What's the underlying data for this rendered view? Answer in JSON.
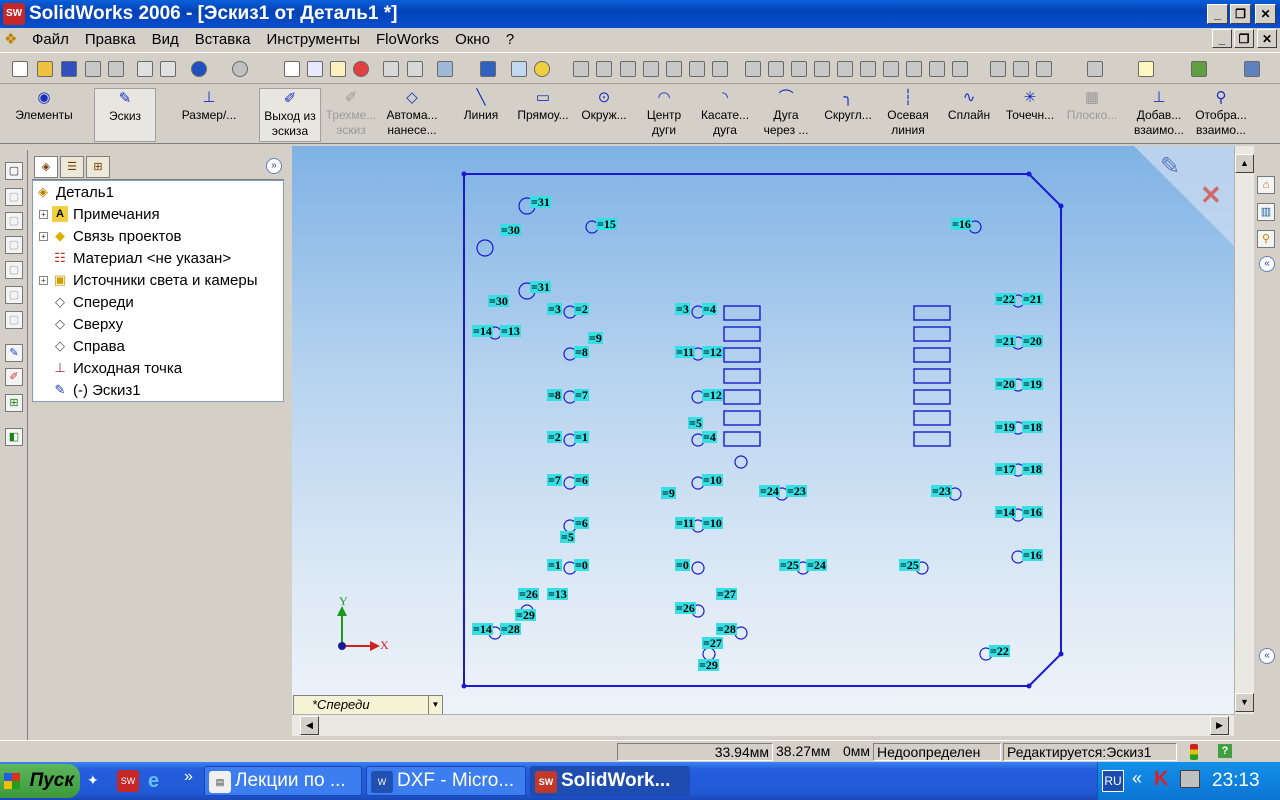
{
  "window": {
    "title": "SolidWorks 2006 - [Эскиз1 от Деталь1 *]"
  },
  "menu": [
    "Файл",
    "Правка",
    "Вид",
    "Вставка",
    "Инструменты",
    "FloWorks",
    "Окно",
    "?"
  ],
  "commands": {
    "elements": "Элементы",
    "sketch": "Эскиз",
    "dimension": "Размер/...",
    "exit_sketch_1": "Выход из",
    "exit_sketch_2": "эскиза",
    "sketch3d_1": "Трехме...",
    "sketch3d_2": "эскиз",
    "auto_1": "Автома...",
    "auto_2": "нанесе...",
    "line": "Линия",
    "rect": "Прямоу...",
    "circle": "Окруж...",
    "carc_1": "Центр",
    "carc_2": "дуги",
    "tarc_1": "Касате...",
    "tarc_2": "дуга",
    "parc_1": "Дуга",
    "parc_2": "через ...",
    "fillet": "Скругл...",
    "cline_1": "Осевая",
    "cline_2": "линия",
    "spline": "Сплайн",
    "point": "Точечн...",
    "plane": "Плоско...",
    "addrel_1": "Добав...",
    "addrel_2": "взаимо...",
    "disprel_1": "Отобра...",
    "disprel_2": "взаимо..."
  },
  "tree": {
    "root": "Деталь1",
    "items": [
      "Примечания",
      "Связь проектов",
      "Материал <не указан>",
      "Источники света и камеры",
      "Спереди",
      "Сверху",
      "Справа",
      "Исходная точка",
      "(-) Эскиз1"
    ]
  },
  "view": {
    "orientation": "*Спереди",
    "axis_x": "X",
    "axis_y": "Y"
  },
  "status": {
    "x": "33.94мм",
    "y": "38.27мм",
    "z": "0мм",
    "state": "Недоопределен",
    "editing": "Редактируется:Эскиз1"
  },
  "taskbar": {
    "start": "Пуск",
    "tasks": [
      "Лекции по ...",
      "DXF - Micro...",
      "SolidWork..."
    ],
    "lang": "RU",
    "time": "23:13"
  },
  "sketch_labels": [
    "=31",
    "=15",
    "=30",
    "=16",
    "=31",
    "=30",
    "=3",
    "=2",
    "=3",
    "=4",
    "=22",
    "=21",
    "=14",
    "=13",
    "=9",
    "=8",
    "=11",
    "=12",
    "=21",
    "=20",
    "=8",
    "=7",
    "=12",
    "=20",
    "=19",
    "=5",
    "=2",
    "=1",
    "=4",
    "=19",
    "=18",
    "=7",
    "=6",
    "=10",
    "=17",
    "=18",
    "=9",
    "=24",
    "=23",
    "=23",
    "=6",
    "=11",
    "=10",
    "=14",
    "=16",
    "=5",
    "=16",
    "=1",
    "=0",
    "=0",
    "=25",
    "=24",
    "=25",
    "=26",
    "=13",
    "=27",
    "=29",
    "=26",
    "=14",
    "=28",
    "=28",
    "=27",
    "=22",
    "=29"
  ]
}
